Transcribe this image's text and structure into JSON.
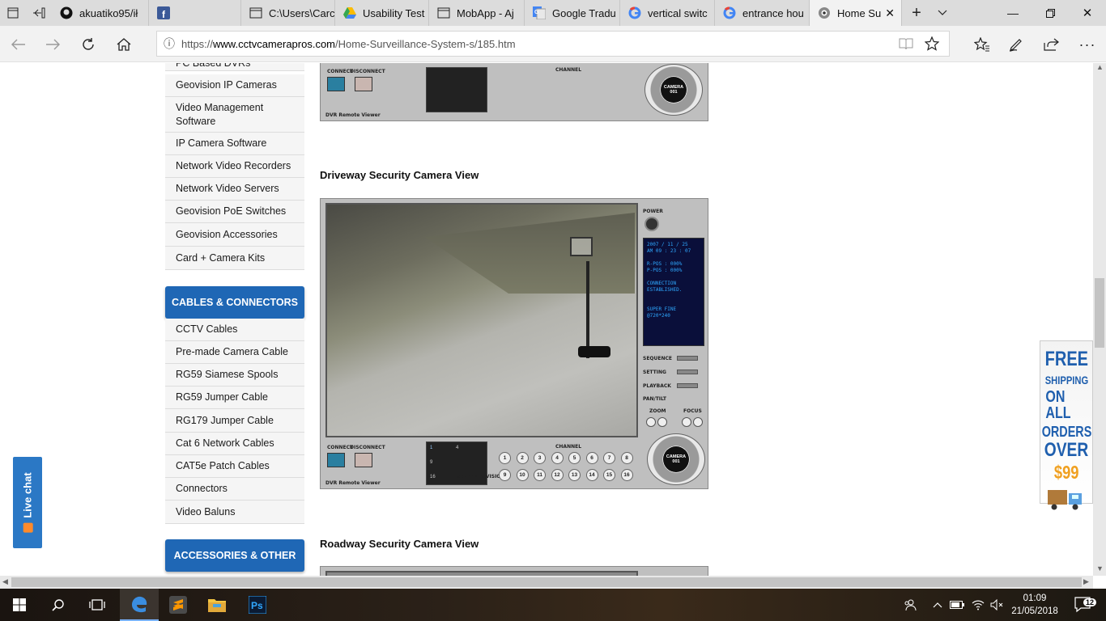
{
  "tabs": [
    {
      "label": "akuatiko95/ił",
      "icon": "github-icon"
    },
    {
      "label": "",
      "icon": "facebook-icon"
    },
    {
      "label": "C:\\Users\\Carc",
      "icon": "window-icon"
    },
    {
      "label": "Usability Test",
      "icon": "google-drive-icon"
    },
    {
      "label": "MobApp - Aj",
      "icon": "window-icon"
    },
    {
      "label": "Google Tradu",
      "icon": "google-translate-icon"
    },
    {
      "label": "vertical switc",
      "icon": "google-icon"
    },
    {
      "label": "entrance hou",
      "icon": "google-icon"
    },
    {
      "label": "Home Su",
      "icon": "cctv-icon"
    }
  ],
  "address": {
    "prefix": "https://",
    "domain": "www.cctvcamerapros.com",
    "path": "/Home-Surveillance-System-s/185.htm"
  },
  "sidebar": {
    "group1": [
      "PC Based DVRs",
      "Geovision IP Cameras",
      "Video Management Software",
      "IP Camera Software",
      "Network Video Recorders",
      "Network Video Servers",
      "Geovision PoE Switches",
      "Geovision Accessories",
      "Card + Camera Kits"
    ],
    "header_cables": "CABLES & CONNECTORS",
    "group2": [
      "CCTV Cables",
      "Pre-made Camera Cable",
      "RG59 Siamese Spools",
      "RG59 Jumper Cable",
      "RG179 Jumper Cable",
      "Cat 6 Network Cables",
      "CAT5e Patch Cables",
      "Connectors",
      "Video Baluns"
    ],
    "header_accessories": "ACCESSORIES & OTHER"
  },
  "content": {
    "driveway_title": "Driveway Security Camera View",
    "roadway_title": "Roadway Security Camera View"
  },
  "dvr": {
    "connect": "CONNECT",
    "disconnect": "DISCONNECT",
    "channel": "CHANNEL",
    "screen_division": "SCREEN DIVISION",
    "footer": "DVR Remote Viewer",
    "power": "POWER",
    "camera": "CAMERA",
    "camera_no": "001",
    "screen_lines": [
      "2007 / 11 / 25",
      "AM 09 : 23 : 07",
      "",
      "R-POS : 000%",
      "P-POS : 000%",
      "",
      "CONNECTION",
      "ESTABLISHED.",
      "",
      "",
      "SUPER FINE",
      "@720*240"
    ],
    "controls": [
      "SEQUENCE",
      "SETTING",
      "PLAYBACK",
      "PAN/TILT"
    ],
    "zoom": "ZOOM",
    "focus": "FOCUS",
    "channels": [
      "1",
      "2",
      "3",
      "4",
      "5",
      "6",
      "7",
      "8",
      "9",
      "10",
      "11",
      "12",
      "13",
      "14",
      "15",
      "16"
    ],
    "split_labels": [
      "1",
      "4",
      "9",
      "16"
    ]
  },
  "promo": {
    "line1": "FREE",
    "line2": "SHIPPING",
    "line3": "ON ALL",
    "line4": "ORDERS",
    "line5": "OVER",
    "line6": "$99"
  },
  "livechat": "Live chat",
  "taskbar": {
    "time": "01:09",
    "date": "21/05/2018",
    "notifications": "12"
  }
}
